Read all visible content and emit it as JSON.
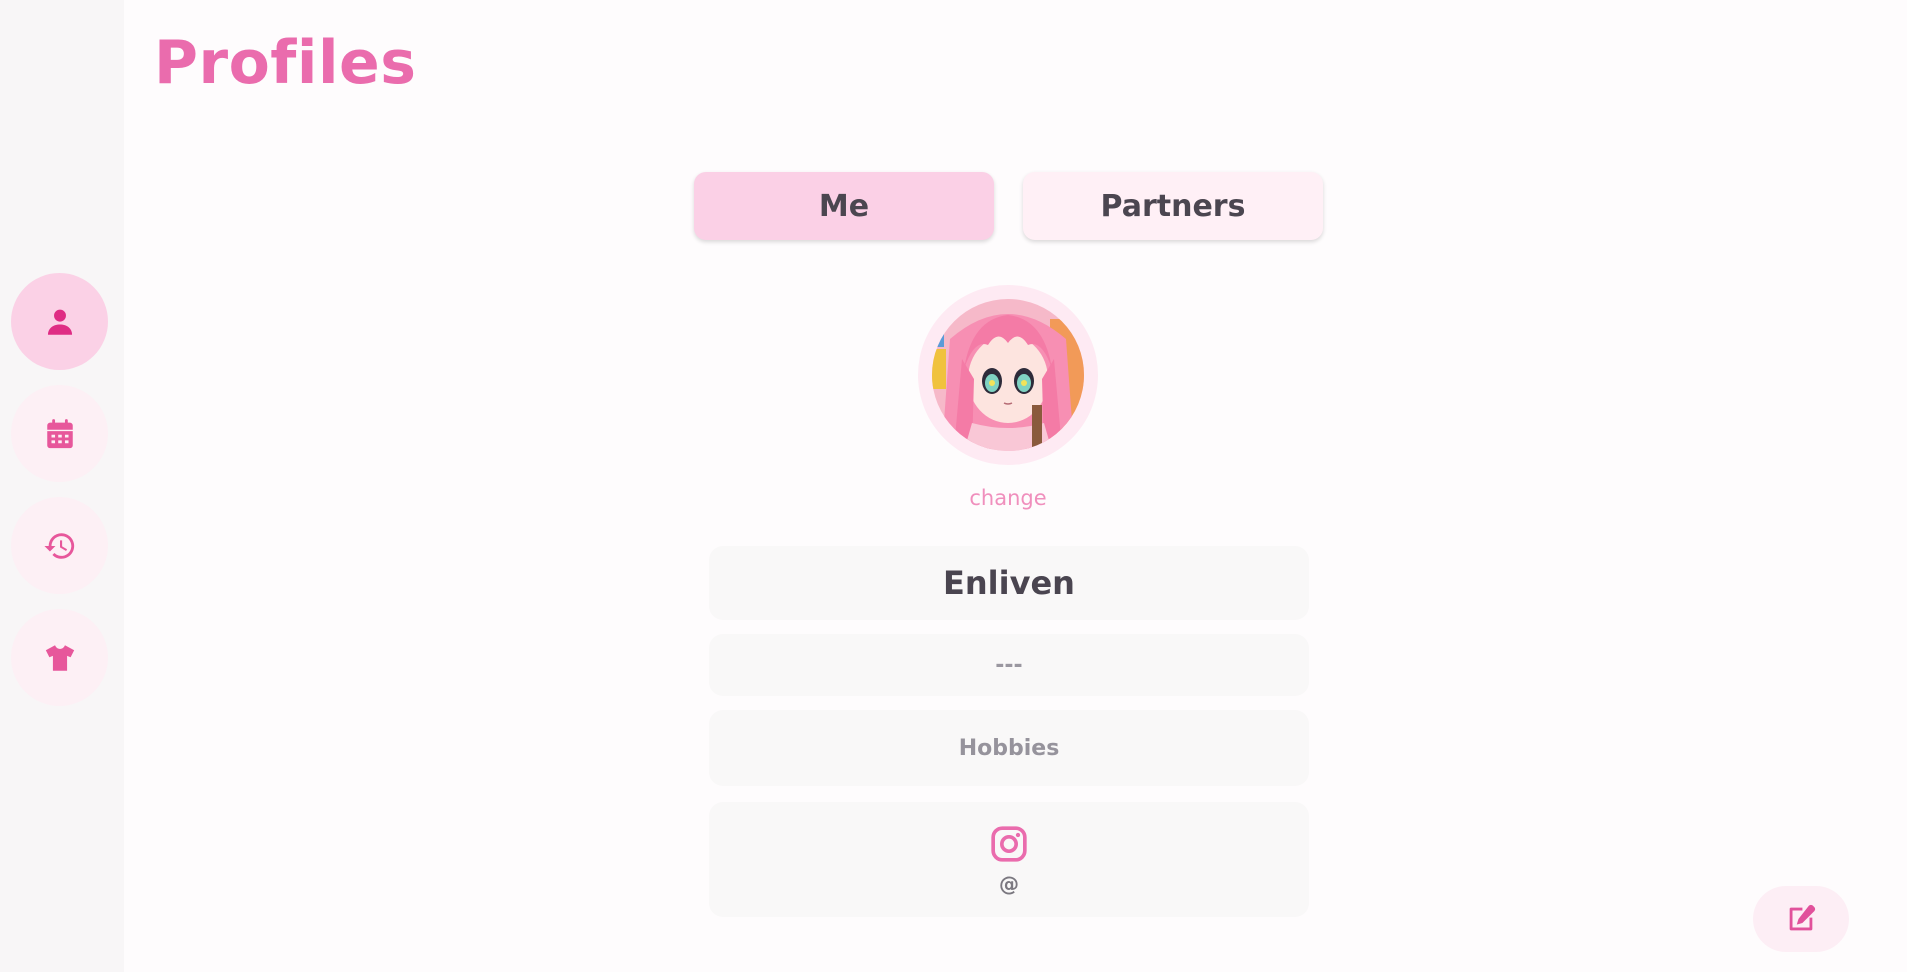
{
  "page": {
    "title": "Profiles"
  },
  "nav": {
    "items": [
      {
        "icon": "person-icon",
        "active": true
      },
      {
        "icon": "calendar-icon",
        "active": false
      },
      {
        "icon": "history-icon",
        "active": false
      },
      {
        "icon": "tshirt-icon",
        "active": false
      }
    ]
  },
  "tabs": [
    {
      "label": "Me",
      "selected": true
    },
    {
      "label": "Partners",
      "selected": false
    }
  ],
  "profile": {
    "change_label": "change",
    "name": "Enliven",
    "pronouns": "---",
    "hobbies": "Hobbies",
    "social": {
      "icon": "instagram-icon",
      "handle": "@"
    }
  },
  "actions": {
    "edit_icon": "edit-icon"
  },
  "colors": {
    "accent": "#ea6cad",
    "tab_selected": "#fbd0e6",
    "tab_unselected": "#fff0f6",
    "rail_bg": "#f8f6f7"
  }
}
